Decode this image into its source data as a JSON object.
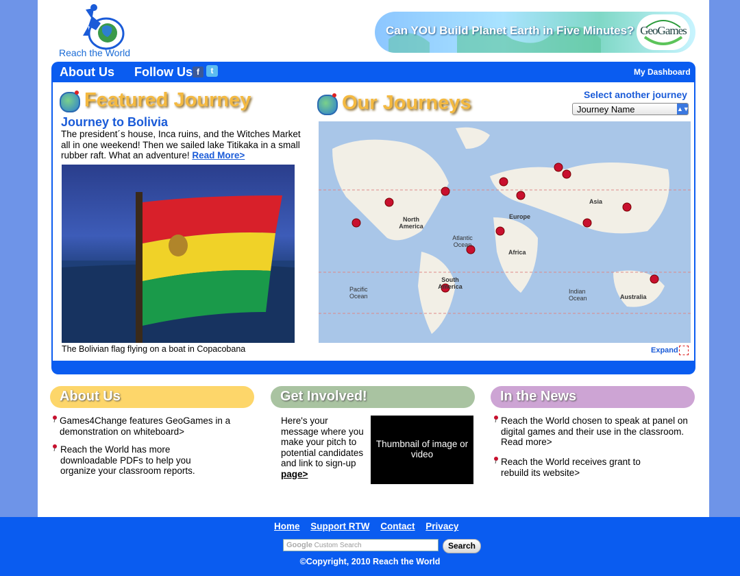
{
  "header": {
    "logo_text": "Reach the World",
    "banner_text": "Can YOU Build Planet Earth in Five Minutes?",
    "banner_badge": "GeoGames"
  },
  "nav": {
    "about": "About Us",
    "follow": "Follow Us",
    "facebook_glyph": "f",
    "twitter_glyph": "t",
    "dashboard": "My Dashboard"
  },
  "featured": {
    "heading": "Featured Journey",
    "title": "Journey to Bolivia",
    "description": "The president´s house, Inca ruins, and the Witches Market all in one weekend! Then we sailed lake Titikaka in a small rubber raft. What an adventure! ",
    "read_more": "Read More>",
    "caption": "The Bolivian flag flying on a boat in Copacobana"
  },
  "journeys": {
    "heading": "Our Journeys",
    "select_label": "Select another journey",
    "select_value": "Journey Name",
    "expand": "Expand",
    "map_labels": {
      "north_america": "North America",
      "atlantic": "Atlantic Ocean",
      "europe": "Europe",
      "asia": "Asia",
      "africa": "Africa",
      "south_america": "South America",
      "pacific": "Pacific Ocean",
      "indian": "Indian Ocean",
      "australia": "Australia"
    }
  },
  "about_section": {
    "heading": "About Us",
    "items": [
      "Games4Change features GeoGames in a demonstration on whiteboard>",
      "Reach the World has more downloadable PDFs to help you organize your classroom reports."
    ]
  },
  "involved": {
    "heading": "Get Involved!",
    "text": "Here's your message where you make your pitch to potential candidates and link to sign-up ",
    "link": "page>",
    "thumb": "Thumbnail of image or video"
  },
  "news": {
    "heading": "In the News",
    "items": [
      "Reach the World chosen to speak at panel on digital games and their use in the classroom. Read more>",
      "Reach the World receives grant to rebuild its website>"
    ]
  },
  "footer": {
    "links": [
      "Home",
      "Support RTW",
      "Contact",
      "Privacy"
    ],
    "search_placeholder": "Custom Search",
    "search_brand": "Google",
    "search_button": "Search",
    "copyright": "©Copyright, 2010 Reach the World"
  },
  "colors": {
    "primary_blue": "#0a5cf0",
    "page_bg": "#6e94e8",
    "about_head": "#fdd66a",
    "involved_head": "#a9c3a1",
    "news_head": "#cda4d4"
  }
}
